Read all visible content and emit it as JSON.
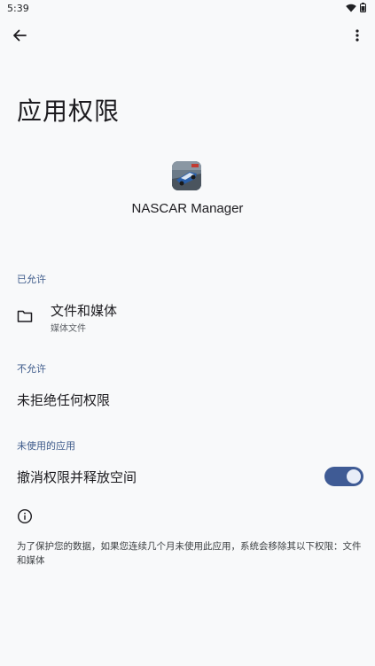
{
  "status_bar": {
    "time": "5:39"
  },
  "header": {
    "title": "应用权限"
  },
  "app": {
    "name": "NASCAR Manager"
  },
  "sections": {
    "allowed": {
      "header": "已允许",
      "items": [
        {
          "title": "文件和媒体",
          "subtitle": "媒体文件",
          "icon": "folder-icon"
        }
      ]
    },
    "denied": {
      "header": "不允许",
      "empty_text": "未拒绝任何权限"
    },
    "unused": {
      "header": "未使用的应用",
      "toggle_label": "撤消权限并释放空间",
      "toggle_on": true,
      "info_text": "为了保护您的数据，如果您连续几个月未使用此应用，系统会移除其以下权限：文件和媒体"
    }
  },
  "colors": {
    "accent": "#3f5b95",
    "section_header": "#3d5a8a",
    "background": "#f8f9fa"
  }
}
